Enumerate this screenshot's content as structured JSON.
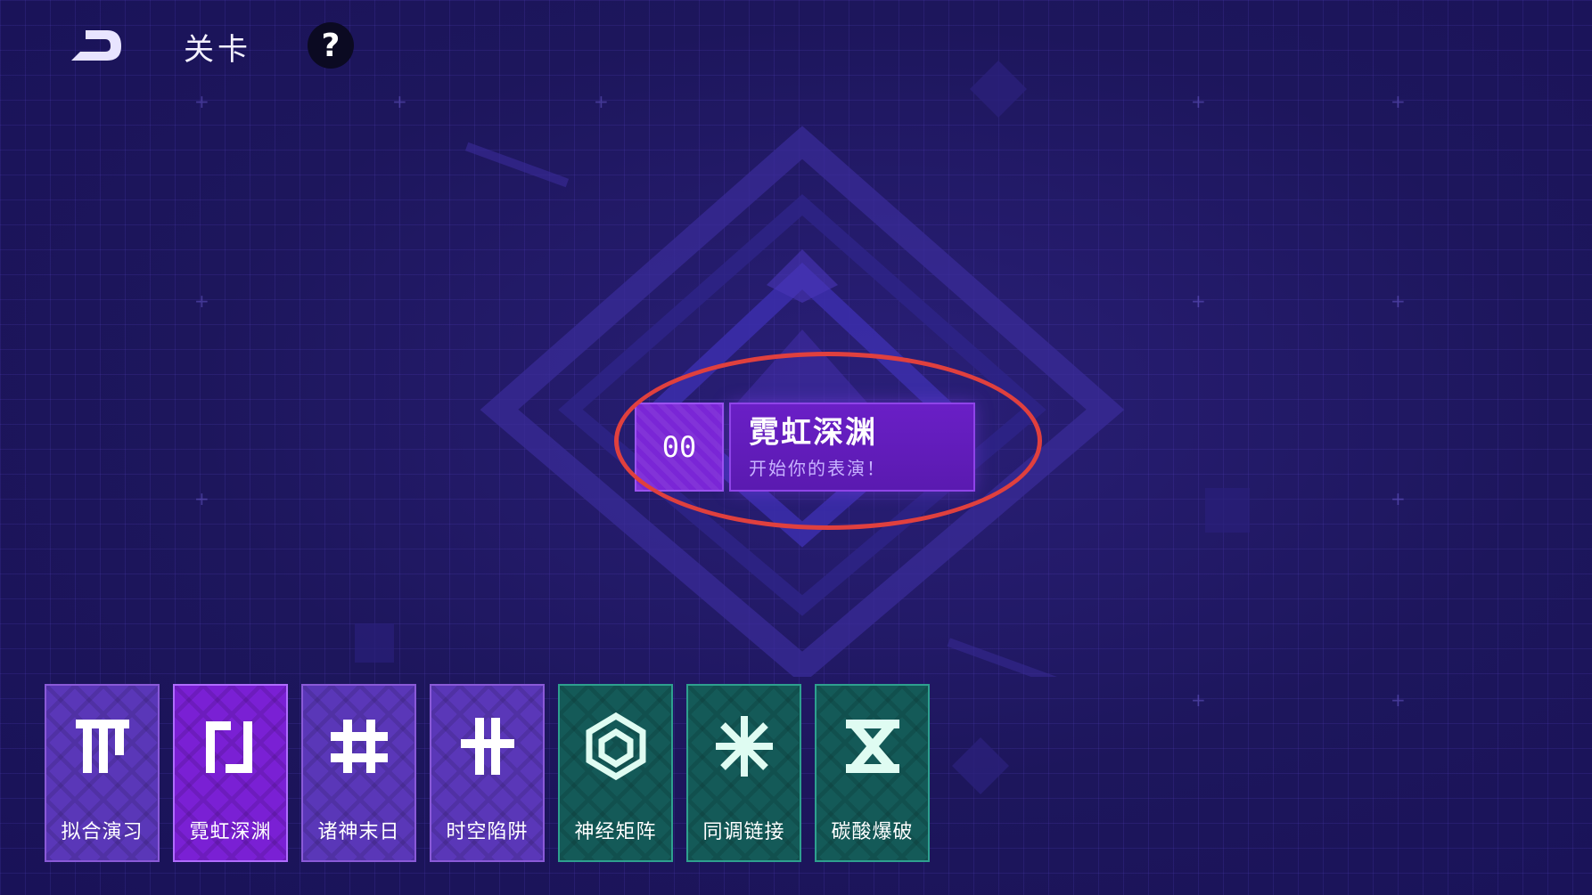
{
  "header": {
    "back_icon": "back-arrow-icon",
    "title": "关卡",
    "help_label": "?"
  },
  "stage": {
    "number": "00",
    "name": "霓虹深渊",
    "subtitle": "开始你的表演！"
  },
  "cards": [
    {
      "label": "拟合演习",
      "icon": "t-bars-icon",
      "theme": "purple"
    },
    {
      "label": "霓虹深渊",
      "icon": "bracket-icon",
      "theme": "purple-selected"
    },
    {
      "label": "诸神末日",
      "icon": "hash-icon",
      "theme": "purple"
    },
    {
      "label": "时空陷阱",
      "icon": "split-cross-icon",
      "theme": "purple"
    },
    {
      "label": "神经矩阵",
      "icon": "knot-icon",
      "theme": "teal"
    },
    {
      "label": "同调链接",
      "icon": "snowflake-icon",
      "theme": "teal"
    },
    {
      "label": "碳酸爆破",
      "icon": "x-bars-icon",
      "theme": "teal"
    }
  ],
  "colors": {
    "background": "#1d165c",
    "highlight_ring": "#e0403e",
    "purple_card": "#5a37b8",
    "selected_card": "#7a20d4",
    "teal_card": "#145a58"
  }
}
